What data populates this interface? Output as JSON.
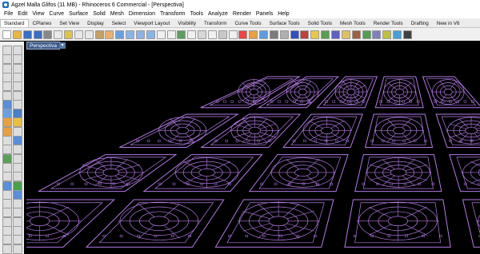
{
  "window": {
    "title": "Agzel Malla Glifos (11 MB) - Rhinoceros 6 Commercial - [Perspectiva]"
  },
  "menu": [
    "File",
    "Edit",
    "View",
    "Curve",
    "Surface",
    "Solid",
    "Mesh",
    "Dimension",
    "Transform",
    "Tools",
    "Analyze",
    "Render",
    "Panels",
    "Help"
  ],
  "tabs": [
    "Standard",
    "CPlanes",
    "Set View",
    "Display",
    "Select",
    "Viewport Layout",
    "Visibility",
    "Transform",
    "Curve Tools",
    "Surface Tools",
    "Solid Tools",
    "Mesh Tools",
    "Render Tools",
    "Drafting",
    "New in V6"
  ],
  "active_tab": "Standard",
  "viewport": {
    "label": "Perspectiva",
    "dropdown": "▾"
  },
  "colors": {
    "curves": "#b47ae6",
    "background": "#000000"
  }
}
